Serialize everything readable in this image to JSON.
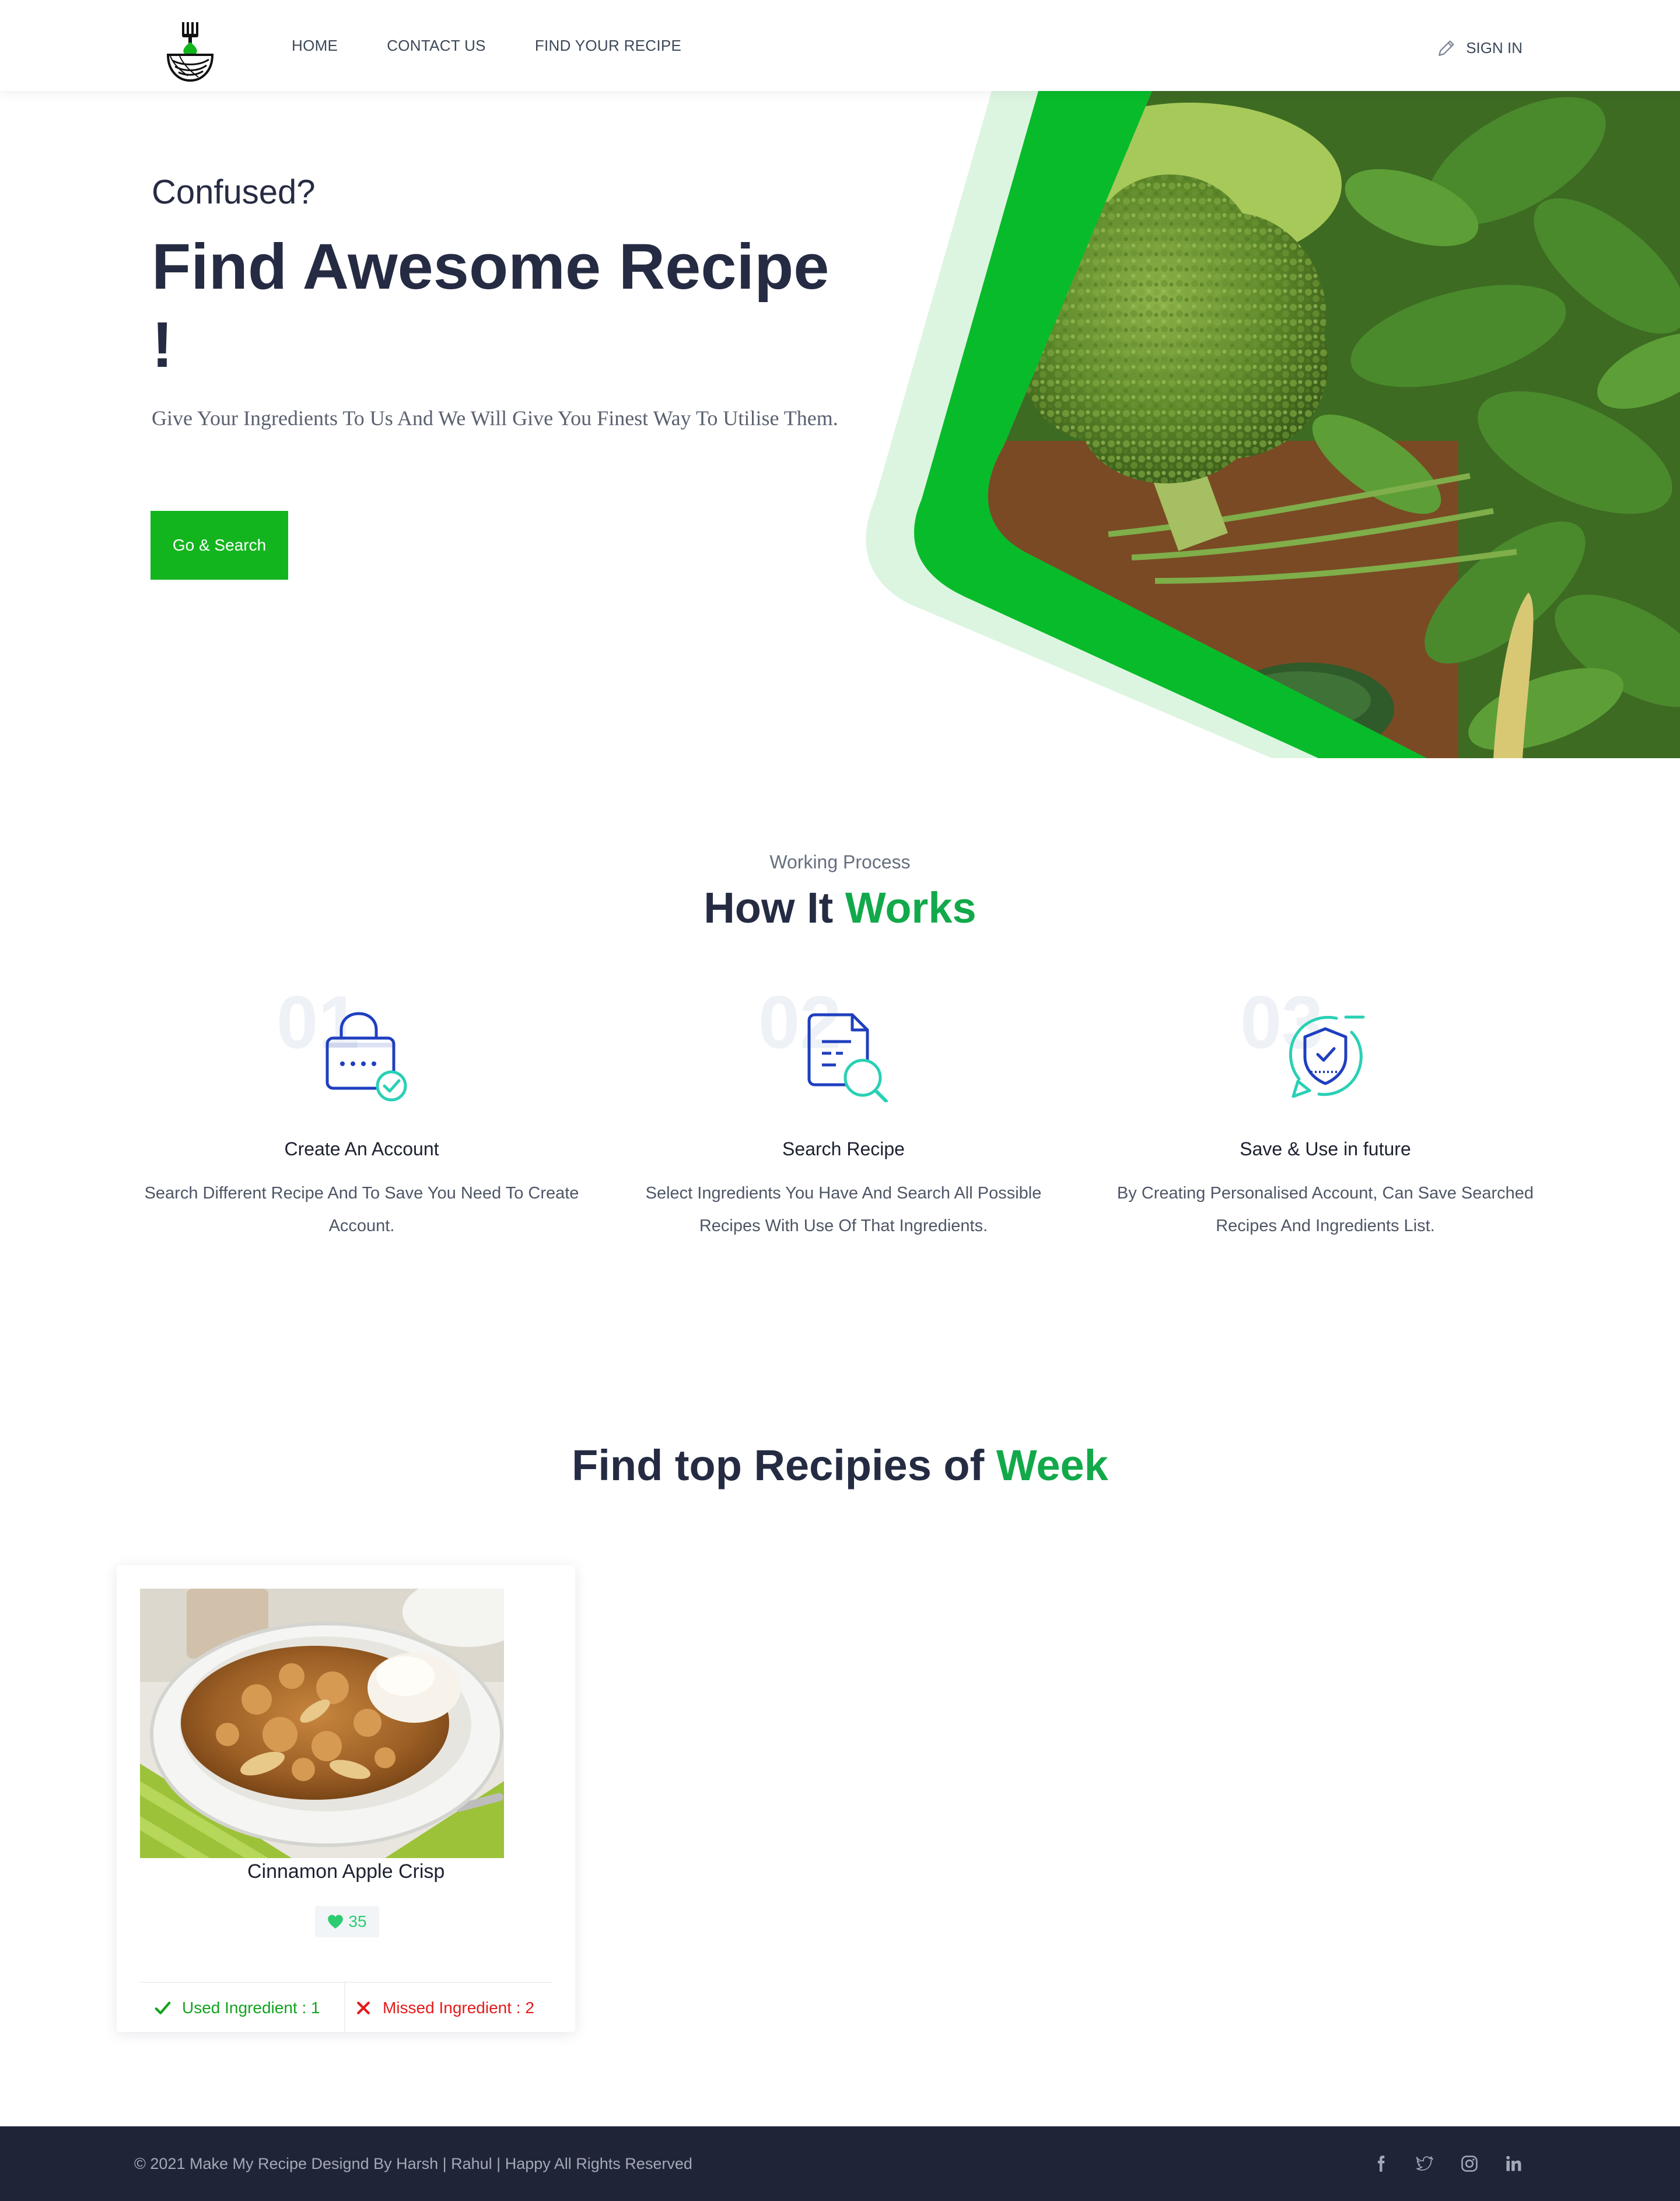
{
  "nav": {
    "links": [
      "HOME",
      "CONTACT US",
      "FIND YOUR RECIPE"
    ],
    "signin_label": "SIGN IN"
  },
  "hero": {
    "kicker": "Confused?",
    "title": "Find Awesome Recipe !",
    "subtitle": "Give Your Ingredients To Us And We Will Give You Finest Way To Utilise Them.",
    "button_label": "Go & Search"
  },
  "how": {
    "kicker": "Working Process",
    "title_plain": "How It ",
    "title_accent": "Works",
    "steps": [
      {
        "number": "01",
        "title": "Create An Account",
        "desc": "Search Different Recipe And To Save You Need To Create Account.",
        "icon": "lock-check-icon"
      },
      {
        "number": "02",
        "title": "Search Recipe",
        "desc": "Select Ingredients You Have And Search All Possible Recipes With Use Of That Ingredients.",
        "icon": "document-search-icon"
      },
      {
        "number": "03",
        "title": "Save & Use in future",
        "desc": "By Creating Personalised Account, Can Save Searched Recipes And Ingredients List.",
        "icon": "shield-check-icon"
      }
    ]
  },
  "recipes": {
    "title_plain": "Find top Recipies of ",
    "title_accent": "Week",
    "cards": [
      {
        "title": "Cinnamon Apple Crisp",
        "likes": "35",
        "used": "Used Ingredient : 1",
        "missed": "Missed Ingredient : 2"
      }
    ]
  },
  "footer": {
    "copyright": "© 2021 Make My Recipe Designd By Harsh | Rahul | Happy All Rights Reserved",
    "social": [
      "facebook-icon",
      "twitter-icon",
      "instagram-icon",
      "linkedin-icon"
    ]
  },
  "colors": {
    "brand_green": "#13b51f",
    "accent_green": "#12a94a",
    "dark_text": "#252b42",
    "footer_bg": "#1f2437",
    "missed_red": "#e31b1b"
  }
}
